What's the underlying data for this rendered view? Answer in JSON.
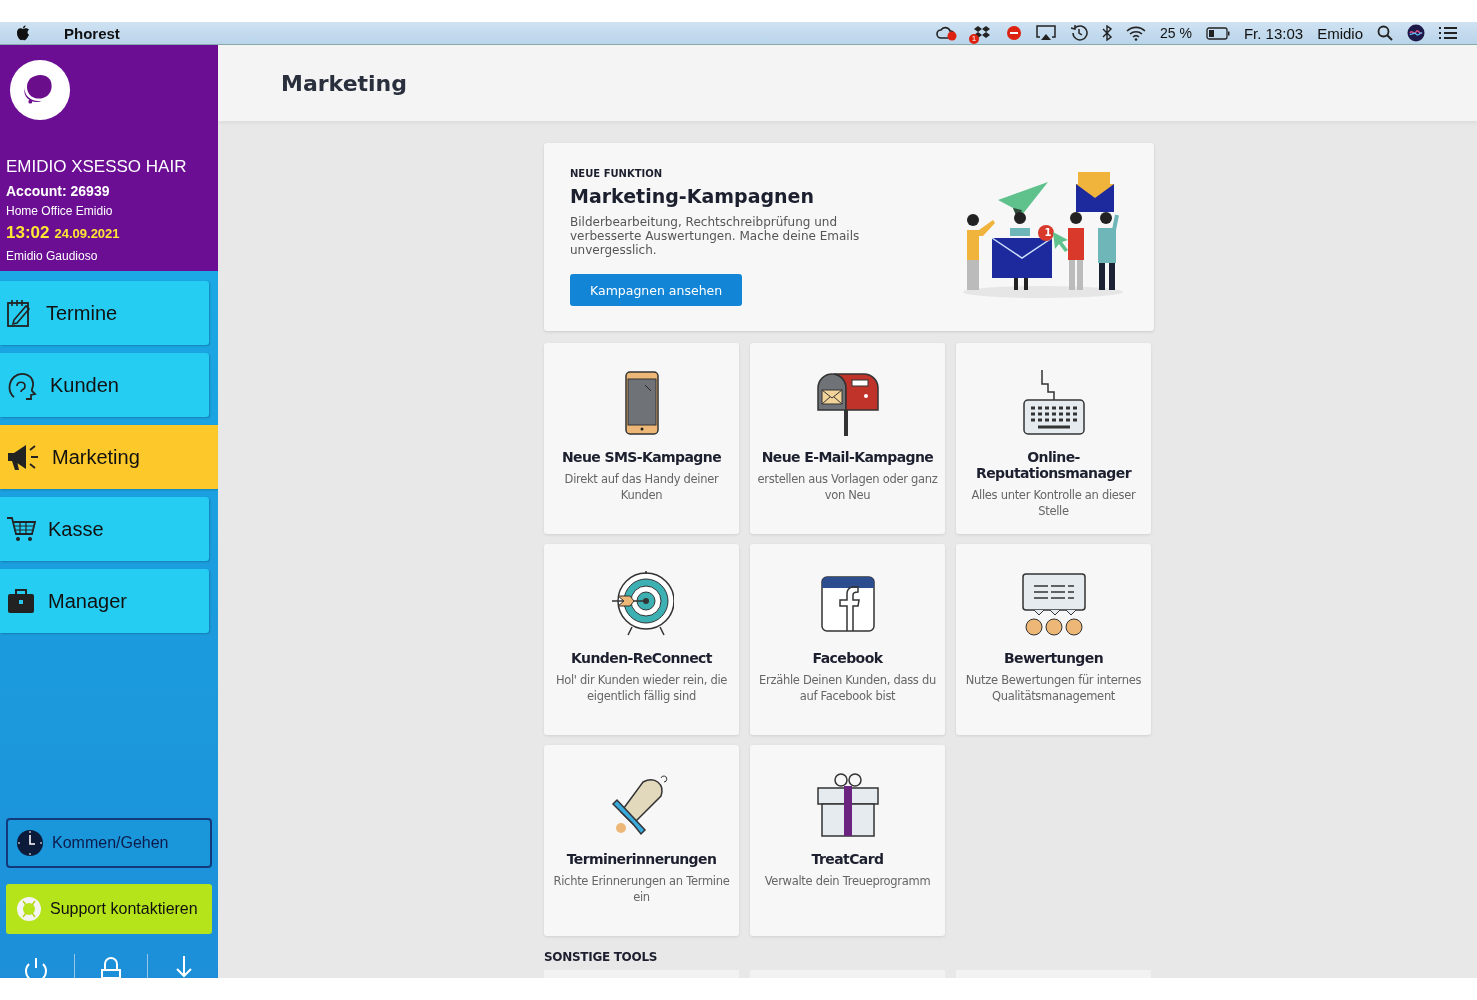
{
  "menubar": {
    "app_name": "Phorest",
    "dropbox_badge": "1",
    "battery": "25 %",
    "clock": "Fr. 13:03",
    "user": "Emidio"
  },
  "sidebar": {
    "business": "EMIDIO XSESSO HAIR",
    "account": "Account: 26939",
    "location": "Home Office Emidio",
    "time": "13:02",
    "date": "24.09.2021",
    "user": "Emidio Gaudioso",
    "nav": [
      {
        "label": "Termine",
        "selected": false
      },
      {
        "label": "Kunden",
        "selected": false
      },
      {
        "label": "Marketing",
        "selected": true
      },
      {
        "label": "Kasse",
        "selected": false
      },
      {
        "label": "Manager",
        "selected": false
      }
    ],
    "clock_button": "Kommen/Gehen",
    "support_button": "Support kontaktieren"
  },
  "main": {
    "title": "Marketing",
    "feature": {
      "eyebrow": "NEUE FUNKTION",
      "title": "Marketing-Kampagnen",
      "text": "Bilderbearbeitung, Rechtschreibprüfung und verbesserte Auswertungen. Mache deine Emails unvergesslich.",
      "button": "Kampagnen ansehen",
      "illustration_badge": "1"
    },
    "tiles": [
      {
        "title": "Neue SMS-Kampagne",
        "description": "Direkt auf das Handy deiner Kunden"
      },
      {
        "title": "Neue E-Mail-Kampagne",
        "description": "erstellen aus Vorlagen oder ganz von Neu"
      },
      {
        "title": "Online-Reputationsmanager",
        "description": "Alles unter Kontrolle an dieser Stelle"
      },
      {
        "title": "Kunden-ReConnect",
        "description": "Hol' dir Kunden wieder rein, die eigentlich fällig sind"
      },
      {
        "title": "Facebook",
        "description": "Erzähle Deinen Kunden, dass du auf Facebook bist"
      },
      {
        "title": "Bewertungen",
        "description": "Nutze Bewertungen für internes Qualitätsmanagement"
      },
      {
        "title": "Terminerinnerungen",
        "description": "Richte Erinnerungen an Termine ein"
      },
      {
        "title": "TreatCard",
        "description": "Verwalte dein Treueprogramm"
      }
    ],
    "section": "SONSTIGE TOOLS"
  }
}
